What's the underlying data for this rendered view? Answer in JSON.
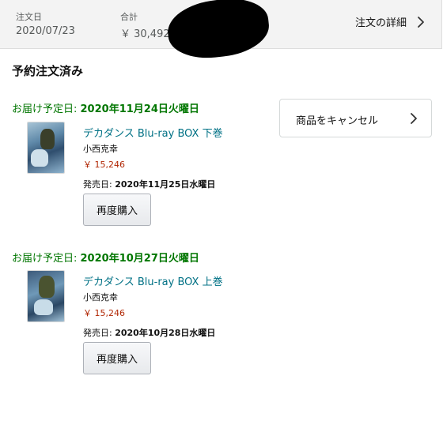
{
  "summary": {
    "order_date_label": "注文日",
    "order_date": "2020/07/23",
    "total_label": "合計",
    "total": "￥ 30,492",
    "details_link": "注文の詳細"
  },
  "status": "予約注文済み",
  "cancel_label": "商品をキャンセル",
  "shipments": [
    {
      "delivery_prefix": "お届け予定日: ",
      "delivery_date": "2020年11月24日火曜日",
      "title": "デカダンス Blu-ray BOX 下巻",
      "author": "小西克幸",
      "price": "￥ 15,246",
      "release_prefix": "発売日: ",
      "release_date": "2020年11月25日水曜日",
      "rebuy_label": "再度購入"
    },
    {
      "delivery_prefix": "お届け予定日: ",
      "delivery_date": "2020年10月27日火曜日",
      "title": "デカダンス Blu-ray BOX 上巻",
      "author": "小西克幸",
      "price": "￥ 15,246",
      "release_prefix": "発売日: ",
      "release_date": "2020年10月28日水曜日",
      "rebuy_label": "再度購入"
    }
  ],
  "colors": {
    "delivery_green": "#007600",
    "link_teal": "#007185",
    "price_red": "#b12704"
  },
  "icons": {
    "details_chevron": "chevron-right-icon",
    "cancel_chevron": "chevron-right-icon"
  }
}
